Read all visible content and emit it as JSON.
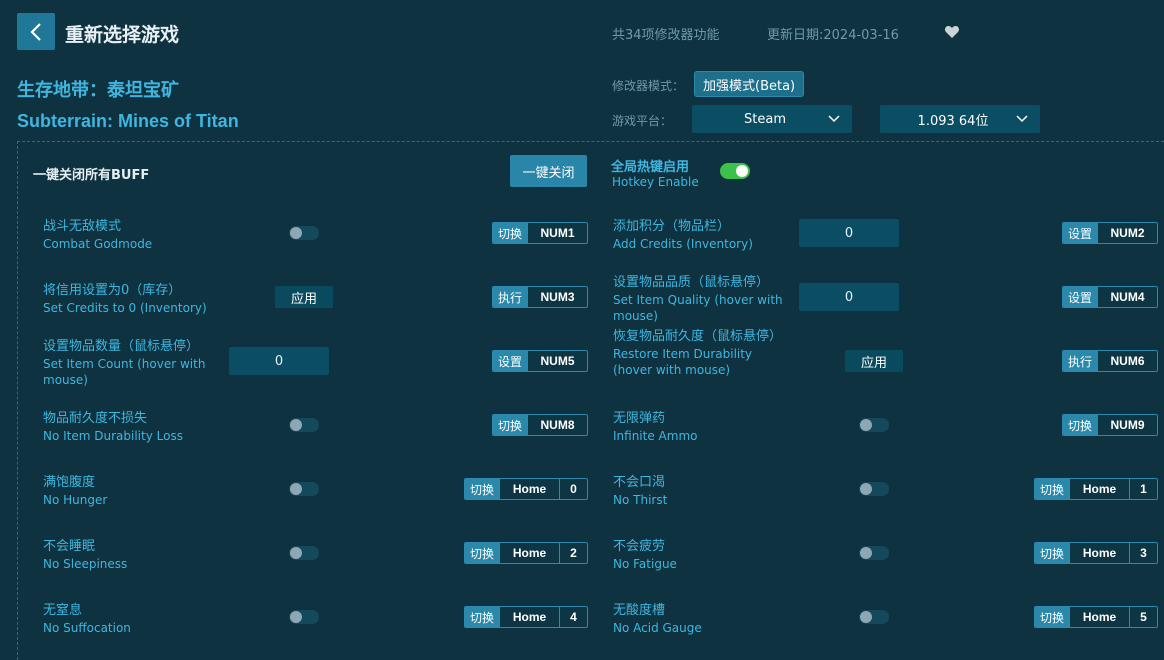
{
  "header": {
    "title": "重新选择游戏",
    "feature_count": "共34项修改器功能",
    "update_date": "更新日期:2024-03-16"
  },
  "game": {
    "name_cn": "生存地带：泰坦宝矿",
    "name_en": "Subterrain: Mines of Titan"
  },
  "settings": {
    "mode_label": "修改器模式：",
    "mode_value": "加强模式(Beta)",
    "platform_label": "游戏平台：",
    "platform_value": "Steam",
    "version_value": "1.093 64位"
  },
  "global": {
    "close_all_label": "一键关闭所有BUFF",
    "close_all_button": "一键关闭",
    "hotkey_cn": "全局热键启用",
    "hotkey_en": "Hotkey Enable"
  },
  "features": [
    {
      "cn": "战斗无敌模式",
      "en": "Combat Godmode",
      "action": "切换",
      "keys": [
        "NUM1"
      ]
    },
    {
      "cn": "添加积分（物品栏）",
      "en": "Add Credits (Inventory)",
      "input": "0",
      "action": "设置",
      "keys": [
        "NUM2"
      ]
    },
    {
      "cn": "将信用设置为0（库存）",
      "en": "Set Credits to 0 (Inventory)",
      "button": "应用",
      "action": "执行",
      "keys": [
        "NUM3"
      ]
    },
    {
      "cn": "设置物品品质（鼠标悬停）",
      "en": "Set Item Quality (hover with mouse)",
      "input": "0",
      "action": "设置",
      "keys": [
        "NUM4"
      ]
    },
    {
      "cn": "设置物品数量（鼠标悬停）",
      "en": "Set Item Count (hover with mouse)",
      "input": "0",
      "action": "设置",
      "keys": [
        "NUM5"
      ]
    },
    {
      "cn": "恢复物品耐久度（鼠标悬停）",
      "en": "Restore Item Durability (hover with mouse)",
      "button": "应用",
      "action": "执行",
      "keys": [
        "NUM6"
      ]
    },
    {
      "cn": "物品耐久度不损失",
      "en": "No Item Durability Loss",
      "action": "切换",
      "keys": [
        "NUM8"
      ]
    },
    {
      "cn": "无限弹药",
      "en": "Infinite Ammo",
      "action": "切换",
      "keys": [
        "NUM9"
      ]
    },
    {
      "cn": "满饱腹度",
      "en": "No Hunger",
      "action": "切换",
      "keys": [
        "Home",
        "0"
      ]
    },
    {
      "cn": "不会口渴",
      "en": "No Thirst",
      "action": "切换",
      "keys": [
        "Home",
        "1"
      ]
    },
    {
      "cn": "不会睡眠",
      "en": "No Sleepiness",
      "action": "切换",
      "keys": [
        "Home",
        "2"
      ]
    },
    {
      "cn": "不会疲劳",
      "en": "No Fatigue",
      "action": "切换",
      "keys": [
        "Home",
        "3"
      ]
    },
    {
      "cn": "无窒息",
      "en": "No Suffocation",
      "action": "切换",
      "keys": [
        "Home",
        "4"
      ]
    },
    {
      "cn": "无酸度槽",
      "en": "No Acid Gauge",
      "action": "切换",
      "keys": [
        "Home",
        "5"
      ]
    }
  ]
}
